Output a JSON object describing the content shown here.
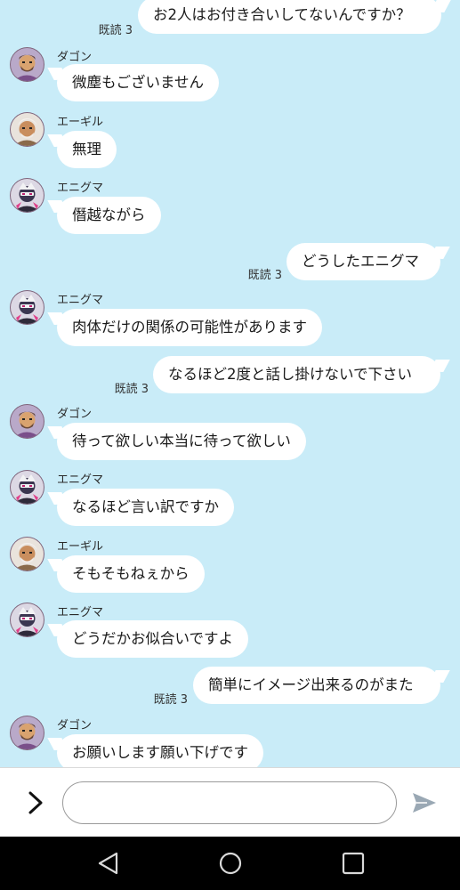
{
  "messages": [
    {
      "side": "right",
      "read_label": "既読",
      "read_count": "3",
      "text": "お2人はお付き合いしてないんですか？"
    },
    {
      "side": "left",
      "sender": "ダゴン",
      "avatar": "dagon",
      "text": "微塵もございません"
    },
    {
      "side": "left",
      "sender": "エーギル",
      "avatar": "aegir",
      "text": "無理"
    },
    {
      "side": "left",
      "sender": "エニグマ",
      "avatar": "enigma",
      "text": "僭越ながら"
    },
    {
      "side": "right",
      "read_label": "既読",
      "read_count": "3",
      "text": "どうしたエニグマ"
    },
    {
      "side": "left",
      "sender": "エニグマ",
      "avatar": "enigma",
      "text": "肉体だけの関係の可能性があります"
    },
    {
      "side": "right",
      "read_label": "既読",
      "read_count": "3",
      "text": "なるほど2度と話し掛けないで下さい"
    },
    {
      "side": "left",
      "sender": "ダゴン",
      "avatar": "dagon",
      "text": "待って欲しい本当に待って欲しい"
    },
    {
      "side": "left",
      "sender": "エニグマ",
      "avatar": "enigma",
      "text": "なるほど言い訳ですか"
    },
    {
      "side": "left",
      "sender": "エーギル",
      "avatar": "aegir",
      "text": "そもそもねぇから"
    },
    {
      "side": "left",
      "sender": "エニグマ",
      "avatar": "enigma",
      "text": "どうだかお似合いですよ"
    },
    {
      "side": "right",
      "read_label": "既読",
      "read_count": "3",
      "text": "簡単にイメージ出来るのがまた"
    },
    {
      "side": "left",
      "sender": "ダゴン",
      "avatar": "dagon",
      "text": "お願いします願い下げです"
    }
  ],
  "input": {
    "value": "",
    "placeholder": ""
  },
  "icons": {
    "expand": "chevron-right-icon",
    "send": "send-icon",
    "nav_back": "back-triangle-icon",
    "nav_home": "home-circle-icon",
    "nav_recents": "recents-square-icon"
  },
  "colors": {
    "background": "#c9ecf8",
    "bubble": "#ffffff",
    "send_icon": "#9aa8b4",
    "navbar": "#000000"
  }
}
